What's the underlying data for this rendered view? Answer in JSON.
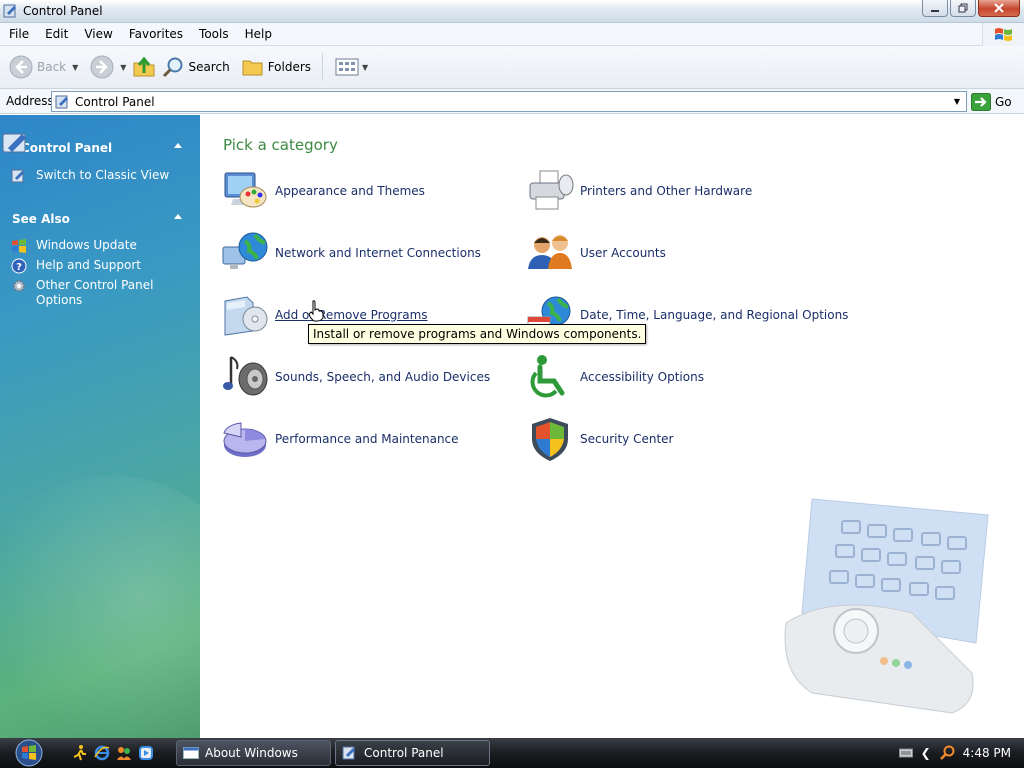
{
  "window": {
    "title": "Control Panel"
  },
  "menubar": {
    "items": [
      "File",
      "Edit",
      "View",
      "Favorites",
      "Tools",
      "Help"
    ]
  },
  "toolbar": {
    "back_label": "Back",
    "search_label": "Search",
    "folders_label": "Folders"
  },
  "address": {
    "label": "Address",
    "value": "Control Panel",
    "go_label": "Go"
  },
  "left_pane": {
    "control_panel_header": "Control Panel",
    "switch_view": "Switch to Classic View",
    "see_also_header": "See Also",
    "links": [
      "Windows Update",
      "Help and Support",
      "Other Control Panel Options"
    ]
  },
  "main": {
    "heading": "Pick a category",
    "categories": [
      {
        "label": "Appearance and Themes",
        "icon": "appearance-themes-icon"
      },
      {
        "label": "Printers and Other Hardware",
        "icon": "printer-icon"
      },
      {
        "label": "Network and Internet Connections",
        "icon": "network-globe-icon"
      },
      {
        "label": "User Accounts",
        "icon": "user-accounts-icon"
      },
      {
        "label": "Add or Remove Programs",
        "icon": "add-remove-programs-icon"
      },
      {
        "label": "Date, Time, Language, and Regional Options",
        "icon": "date-time-globe-icon"
      },
      {
        "label": "Sounds, Speech, and Audio Devices",
        "icon": "speaker-icon"
      },
      {
        "label": "Accessibility Options",
        "icon": "accessibility-icon"
      },
      {
        "label": "Performance and Maintenance",
        "icon": "pie-chart-icon"
      },
      {
        "label": "Security Center",
        "icon": "security-shield-icon"
      }
    ],
    "tooltip": "Install or remove programs and Windows components."
  },
  "taskbar": {
    "tasks": [
      "About Windows",
      "Control Panel"
    ],
    "clock": "4:48 PM"
  },
  "colors": {
    "heading_green": "#3c8a43",
    "link_blue": "#1a2f6a",
    "tooltip_bg": "#ffffe1"
  }
}
